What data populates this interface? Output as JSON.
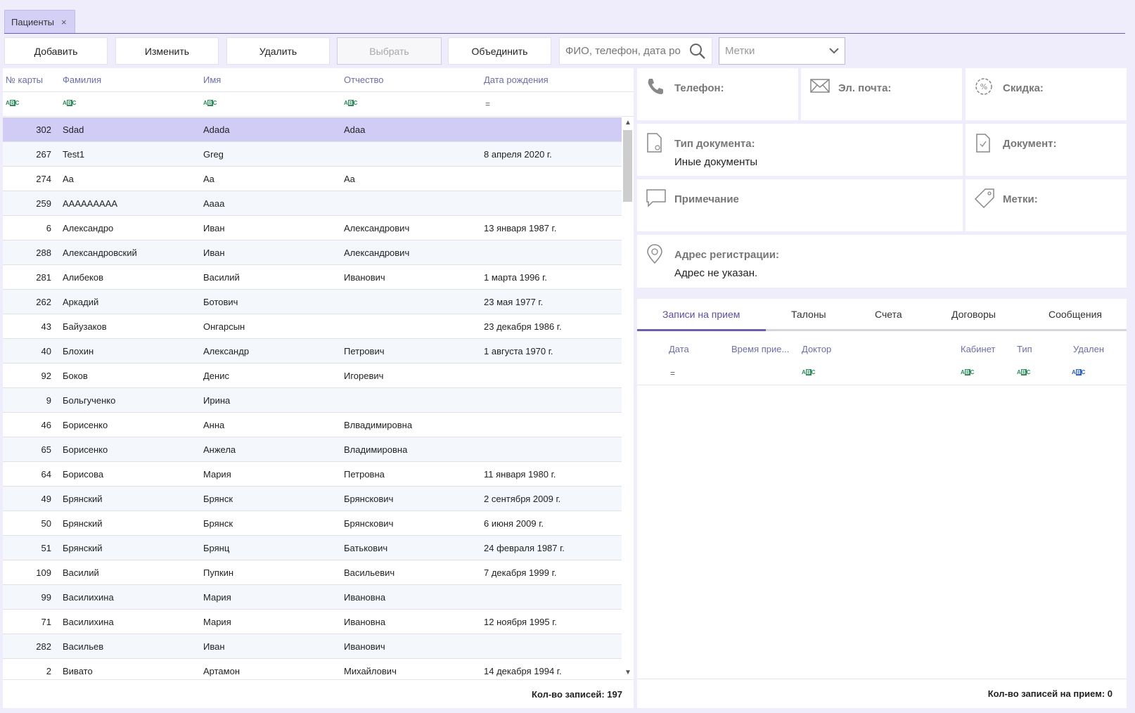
{
  "tabs": {
    "patients": {
      "label": "Пациенты",
      "close": "×"
    }
  },
  "toolbar": {
    "add": "Добавить",
    "edit": "Изменить",
    "delete": "Удалить",
    "select": "Выбрать",
    "merge": "Объединить",
    "search_placeholder": "ФИО, телефон, дата ро",
    "tags_placeholder": "Метки"
  },
  "grid": {
    "headers": {
      "card": "№ карты",
      "last": "Фамилия",
      "first": "Имя",
      "middle": "Отчество",
      "dob": "Дата рождения"
    },
    "filter_eq": "=",
    "rows": [
      {
        "card": "302",
        "last": "Sdad",
        "first": "Adada",
        "middle": "Adaa",
        "dob": ""
      },
      {
        "card": "267",
        "last": "Test1",
        "first": "Greg",
        "middle": "",
        "dob": "8 апреля 2020 г."
      },
      {
        "card": "274",
        "last": "Aa",
        "first": "Aa",
        "middle": "Aa",
        "dob": ""
      },
      {
        "card": "259",
        "last": "AAAAAAAAA",
        "first": "Aaaa",
        "middle": "",
        "dob": ""
      },
      {
        "card": "6",
        "last": "Александро",
        "first": "Иван",
        "middle": "Александрович",
        "dob": "13 января 1987 г."
      },
      {
        "card": "288",
        "last": "Александровский",
        "first": "Иван",
        "middle": "Александрович",
        "dob": ""
      },
      {
        "card": "281",
        "last": "Алибеков",
        "first": "Василий",
        "middle": "Иванович",
        "dob": "1 марта 1996 г."
      },
      {
        "card": "262",
        "last": "Аркадий",
        "first": "Ботович",
        "middle": "",
        "dob": "23 мая 1977 г."
      },
      {
        "card": "43",
        "last": "Байузаков",
        "first": "Онгарсын",
        "middle": "",
        "dob": "23 декабря 1986 г."
      },
      {
        "card": "40",
        "last": "Блохин",
        "first": "Александр",
        "middle": "Петрович",
        "dob": "1 августа 1970 г."
      },
      {
        "card": "92",
        "last": "Боков",
        "first": "Денис",
        "middle": "Игоревич",
        "dob": ""
      },
      {
        "card": "9",
        "last": "Больгученко",
        "first": "Ирина",
        "middle": "",
        "dob": ""
      },
      {
        "card": "46",
        "last": "Борисенко",
        "first": "Анна",
        "middle": "Влвадимировна",
        "dob": ""
      },
      {
        "card": "65",
        "last": "Борисенко",
        "first": "Анжела",
        "middle": "Владимировна",
        "dob": ""
      },
      {
        "card": "64",
        "last": "Борисова",
        "first": "Мария",
        "middle": "Петровна",
        "dob": "11 января 1980 г."
      },
      {
        "card": "49",
        "last": "Брянский",
        "first": "Брянск",
        "middle": "Брянскович",
        "dob": "2 сентября 2009 г."
      },
      {
        "card": "50",
        "last": "Брянский",
        "first": "Брянск",
        "middle": "Брянскович",
        "dob": "6 июня 2009 г."
      },
      {
        "card": "51",
        "last": "Брянский",
        "first": "Брянц",
        "middle": "Батькович",
        "dob": "24 февраля 1987 г."
      },
      {
        "card": "109",
        "last": "Василий",
        "first": "Пупкин",
        "middle": "Васильевич",
        "dob": "7 декабря 1999 г."
      },
      {
        "card": "99",
        "last": "Василихина",
        "first": "Мария",
        "middle": "Ивановна",
        "dob": ""
      },
      {
        "card": "71",
        "last": "Василихина",
        "first": "Мария",
        "middle": "Ивановна",
        "dob": "12 ноября 1995 г."
      },
      {
        "card": "282",
        "last": "Васильев",
        "first": "Иван",
        "middle": "Иванович",
        "dob": ""
      },
      {
        "card": "2",
        "last": "Вивато",
        "first": "Артамон",
        "middle": "Михайлович",
        "dob": "14 декабря 1994 г."
      }
    ],
    "count_label": "Кол-во записей: 197"
  },
  "info": {
    "phone": "Телефон:",
    "email": "Эл. почта:",
    "discount": "Скидка:",
    "doc_type": "Тип документа:",
    "doc_type_value": "Иные документы",
    "document": "Документ:",
    "note": "Примечание",
    "tags": "Метки:",
    "address": "Адрес регистрации:",
    "address_value": "Адрес не указан."
  },
  "appointments": {
    "tabs": [
      "Записи на прием",
      "Талоны",
      "Счета",
      "Договоры",
      "Сообщения"
    ],
    "headers": {
      "date": "Дата",
      "time": "Время прие...",
      "doctor": "Доктор",
      "cabinet": "Кабинет",
      "type": "Тип",
      "deleted": "Удален"
    },
    "filter_eq": "=",
    "count_label": "Кол-во записей на прием: 0"
  },
  "colors": {
    "accent": "#6e5eb0",
    "selected_row": "#d1ccf6",
    "header_text": "#6a6fa6",
    "background": "#efedfb"
  }
}
